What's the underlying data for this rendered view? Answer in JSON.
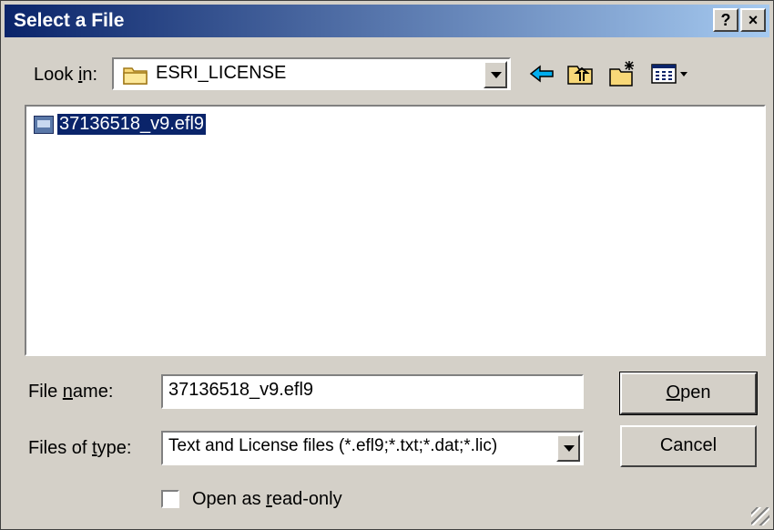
{
  "window": {
    "title": "Select a File",
    "help_label": "?",
    "close_label": "×"
  },
  "lookin": {
    "label_pre": "Look ",
    "label_key": "i",
    "label_post": "n:",
    "value": "ESRI_LICENSE",
    "folder_icon": "folder-icon"
  },
  "toolbar": {
    "icons": [
      "back-arrow-icon",
      "up-folder-icon",
      "new-folder-icon",
      "view-menu-icon"
    ]
  },
  "files": [
    {
      "name": "37136518_v9.efl9",
      "icon": "license-file-icon",
      "selected": true
    }
  ],
  "filename": {
    "label_pre": "File ",
    "label_key": "n",
    "label_post": "ame:",
    "value": "37136518_v9.efl9"
  },
  "filetype": {
    "label_pre": "Files of ",
    "label_key": "t",
    "label_post": "ype:",
    "value": "Text and License files (*.efl9;*.txt;*.dat;*.lic)"
  },
  "buttons": {
    "open_key": "O",
    "open_rest": "pen",
    "cancel": "Cancel"
  },
  "readonly": {
    "label_pre": "Open as ",
    "label_key": "r",
    "label_post": "ead-only",
    "checked": false
  },
  "colors": {
    "title_start": "#0a246a",
    "title_end": "#a6caf0",
    "selection": "#0a246a",
    "face": "#d4d0c8",
    "back_arrow": "#00aeef"
  }
}
